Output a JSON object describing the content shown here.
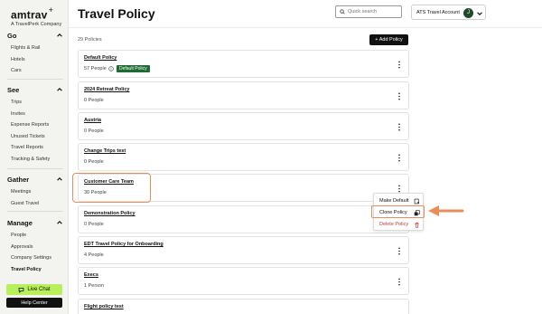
{
  "brand": {
    "name": "amtrav",
    "plus": "+",
    "tagline": "A TravelPerk Company"
  },
  "sidebar": {
    "sections": [
      {
        "title": "Go",
        "items": [
          "Flights & Rail",
          "Hotels",
          "Cars"
        ]
      },
      {
        "title": "See",
        "items": [
          "Trips",
          "Invites",
          "Expense Reports",
          "Unused Tickets",
          "Travel Reports",
          "Tracking & Safety"
        ]
      },
      {
        "title": "Gather",
        "items": [
          "Meetings",
          "Guest Travel"
        ]
      },
      {
        "title": "Manage",
        "items": [
          "People",
          "Approvals",
          "Company Settings",
          "Travel Policy"
        ]
      }
    ],
    "active_item": "Travel Policy",
    "live_chat_label": "Live Chat",
    "help_center_label": "Help Center"
  },
  "header": {
    "title": "Travel Policy",
    "search_placeholder": "Quick search",
    "account_name": "ATS Travel Account",
    "avatar_initial": "J"
  },
  "list": {
    "count_label": "29 Policies",
    "add_button_label": "+ Add Policy",
    "policies": [
      {
        "name": "Default Policy",
        "people": "57 People",
        "badge": "Default Policy"
      },
      {
        "name": "2024 Retreat Policy",
        "people": "0 People"
      },
      {
        "name": "Austria",
        "people": "0 People"
      },
      {
        "name": "Change Trips test",
        "people": "0 People"
      },
      {
        "name": "Customer Care Team",
        "people": "30 People"
      },
      {
        "name": "Demonstration Policy",
        "people": "0 People"
      },
      {
        "name": "EDT Travel Policy for Onboarding",
        "people": "4 People"
      },
      {
        "name": "Execs",
        "people": "1 Person"
      },
      {
        "name": "Flight policy test",
        "people": ""
      }
    ]
  },
  "context_menu": {
    "items": [
      "Make Default",
      "Clone Policy",
      "Delete Policy"
    ],
    "highlighted": "Clone Policy"
  },
  "colors": {
    "sidebar_bg": "#f3f3ef",
    "accent_green": "#b7f05a",
    "badge_green": "#1e6b34",
    "highlight_orange": "#e98d5b",
    "danger_red": "#c6363b"
  }
}
